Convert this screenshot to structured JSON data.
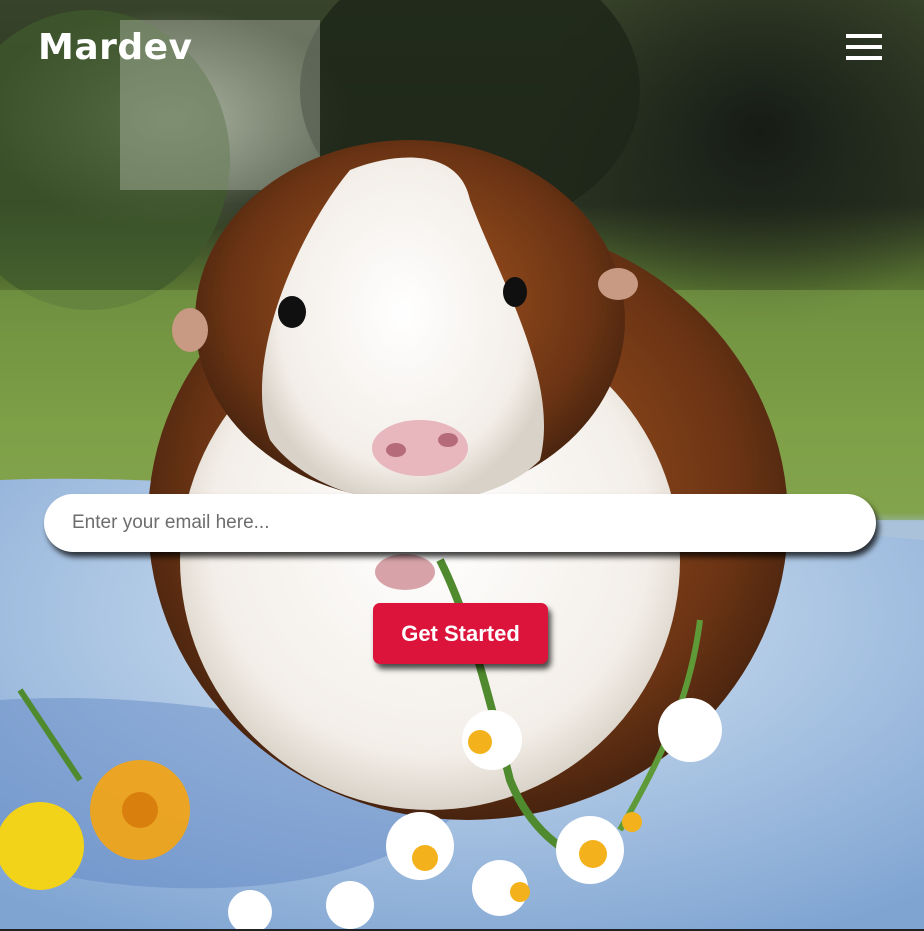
{
  "header": {
    "brand": "Mardev",
    "menu_icon": "hamburger-menu-icon"
  },
  "hero": {
    "background_subject": "guinea pig on blue towel with daisies",
    "email_input": {
      "value": "",
      "placeholder": "Enter your email here..."
    },
    "cta_label": "Get Started"
  },
  "colors": {
    "cta_background": "#dc143c",
    "input_background": "#ffffff",
    "header_text": "#ffffff"
  }
}
